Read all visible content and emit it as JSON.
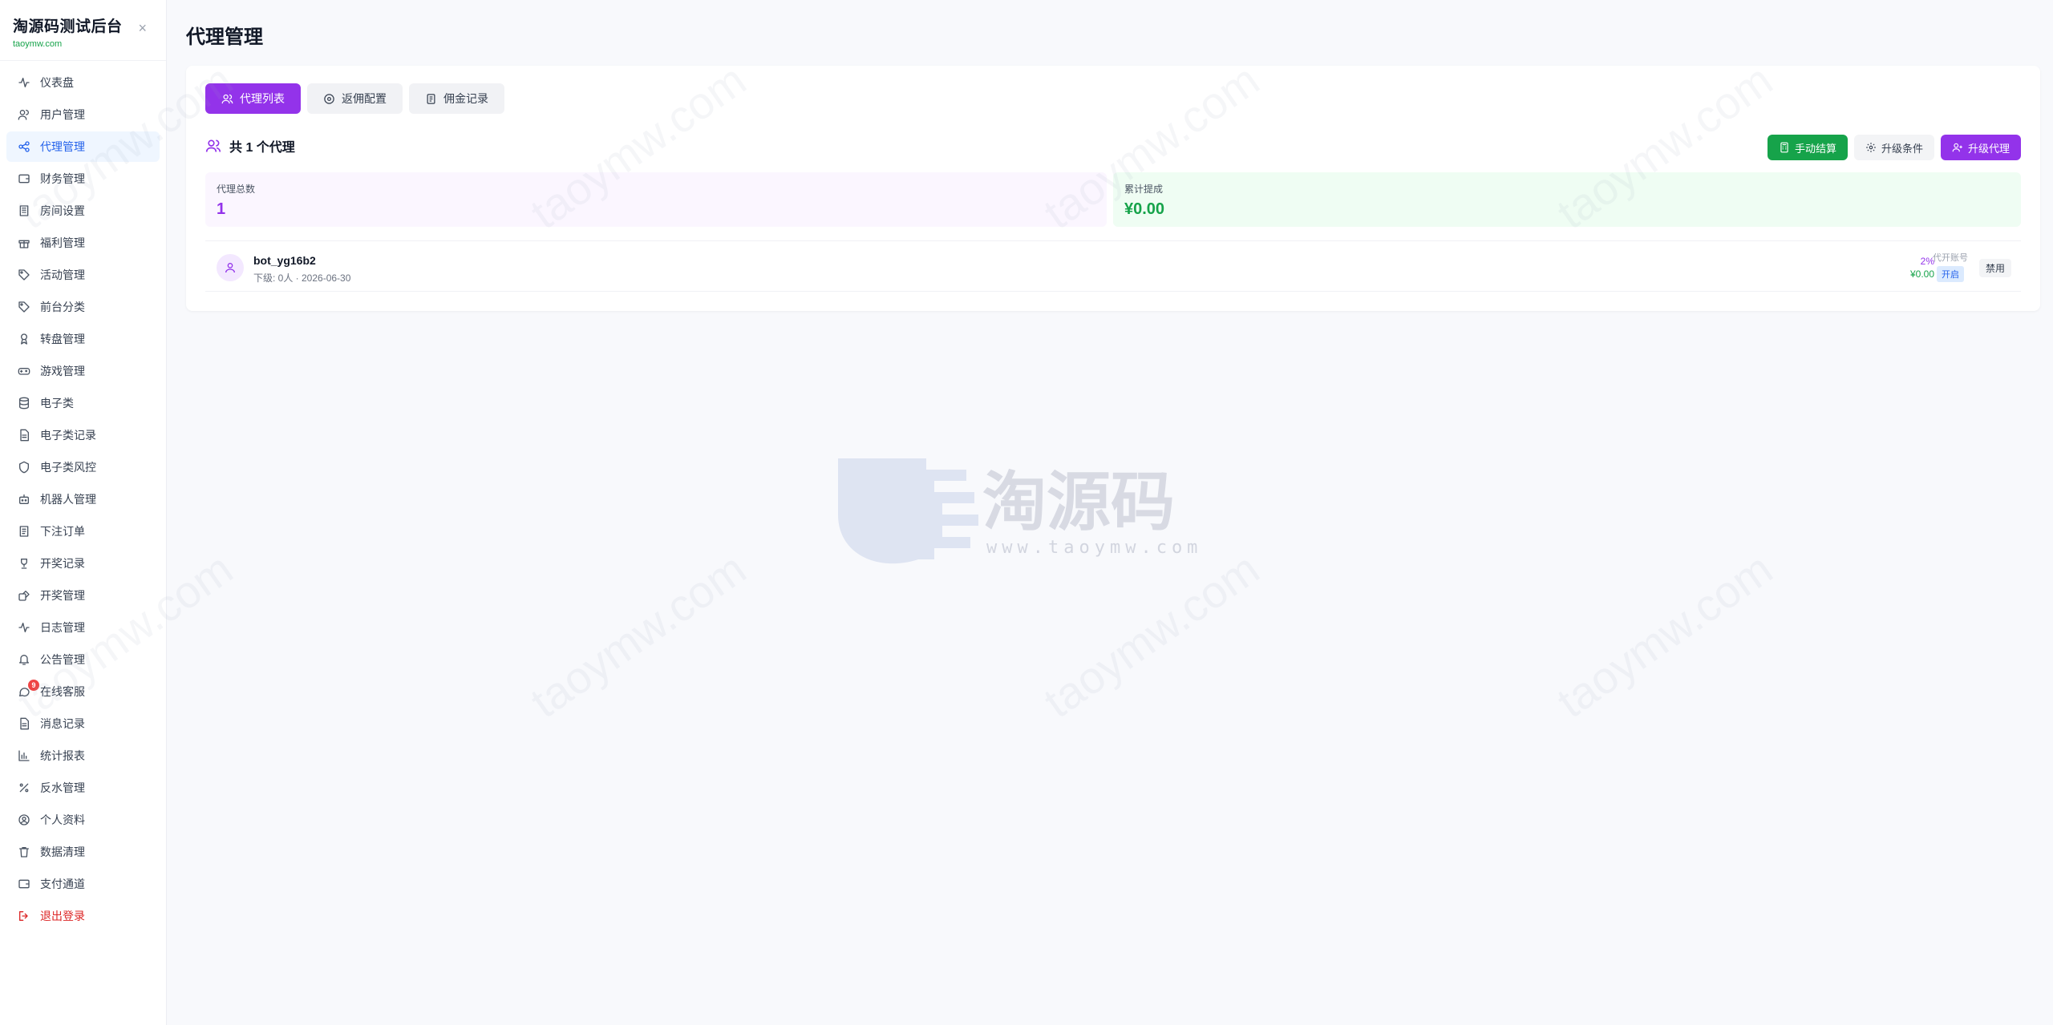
{
  "sidebar": {
    "brand_title": "淘源码测试后台",
    "brand_sub": "taoymw.com",
    "close_glyph": "×",
    "items": [
      {
        "label": "仪表盘",
        "icon": "activity-icon"
      },
      {
        "label": "用户管理",
        "icon": "users-icon"
      },
      {
        "label": "代理管理",
        "icon": "share-icon",
        "active": true
      },
      {
        "label": "财务管理",
        "icon": "wallet-icon"
      },
      {
        "label": "房间设置",
        "icon": "building-icon"
      },
      {
        "label": "福利管理",
        "icon": "gift-icon"
      },
      {
        "label": "活动管理",
        "icon": "tag-icon"
      },
      {
        "label": "前台分类",
        "icon": "tag-icon"
      },
      {
        "label": "转盘管理",
        "icon": "award-icon"
      },
      {
        "label": "游戏管理",
        "icon": "gamepad-icon"
      },
      {
        "label": "电子类",
        "icon": "database-icon"
      },
      {
        "label": "电子类记录",
        "icon": "file-icon"
      },
      {
        "label": "电子类风控",
        "icon": "shield-icon"
      },
      {
        "label": "机器人管理",
        "icon": "bot-icon"
      },
      {
        "label": "下注订单",
        "icon": "receipt-icon"
      },
      {
        "label": "开奖记录",
        "icon": "trophy-icon"
      },
      {
        "label": "开奖管理",
        "icon": "dice-icon"
      },
      {
        "label": "日志管理",
        "icon": "activity-icon"
      },
      {
        "label": "公告管理",
        "icon": "bell-icon"
      },
      {
        "label": "在线客服",
        "icon": "message-icon",
        "badge": "9"
      },
      {
        "label": "消息记录",
        "icon": "file-icon"
      },
      {
        "label": "统计报表",
        "icon": "bar-chart-icon"
      },
      {
        "label": "反水管理",
        "icon": "percent-icon"
      },
      {
        "label": "个人资料",
        "icon": "user-circle-icon"
      },
      {
        "label": "数据清理",
        "icon": "trash-icon"
      },
      {
        "label": "支付通道",
        "icon": "wallet-icon"
      },
      {
        "label": "退出登录",
        "icon": "logout-icon",
        "danger": true
      }
    ]
  },
  "main": {
    "page_title": "代理管理",
    "tabs": [
      {
        "label": "代理列表",
        "active": true
      },
      {
        "label": "返佣配置"
      },
      {
        "label": "佣金记录"
      }
    ],
    "count_text": "共 1 个代理",
    "actions": {
      "settle": "手动结算",
      "conditions": "升级条件",
      "upgrade": "升级代理"
    },
    "stats": {
      "total_label": "代理总数",
      "total_value": "1",
      "commission_label": "累计提成",
      "commission_value": "¥0.00"
    },
    "agents": [
      {
        "name": "bot_yg16b2",
        "meta": "下级: 0人 · 2026-06-30",
        "rate": "2%",
        "amount": "¥0.00",
        "open_label": "代开账号",
        "open_badge": "开启",
        "disable": "禁用"
      }
    ]
  },
  "watermark": {
    "brand": "淘源码",
    "url": "www.taoymw.com",
    "tile": "taoymw.com"
  },
  "colors": {
    "primary_purple": "#9333ea",
    "success_green": "#16a34a",
    "active_blue": "#2563eb",
    "danger_red": "#dc2626"
  }
}
